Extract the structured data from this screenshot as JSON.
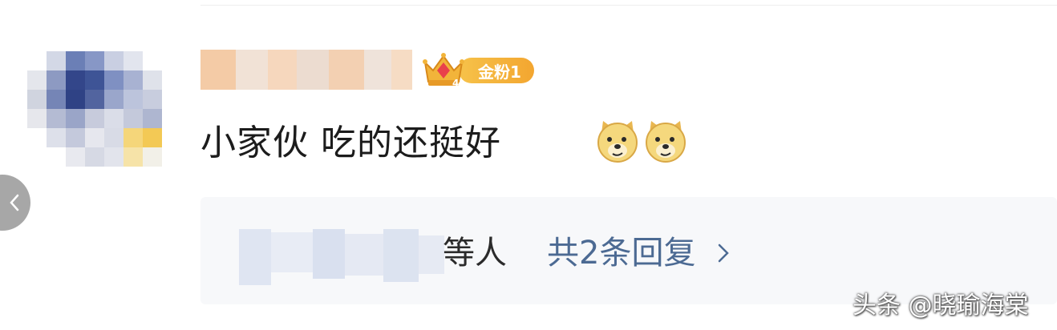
{
  "comment": {
    "badge_label": "金粉1",
    "badge_level": "4",
    "text": "小家伙 吃的还挺好",
    "emoji": [
      "doge-emoji",
      "doge-emoji"
    ]
  },
  "replies": {
    "people_suffix": "等人",
    "link_text": "共2条回复"
  },
  "watermark": "头条 @晓瑜海棠",
  "colors": {
    "link": "#4c6a93",
    "badge": "#f3a630",
    "reply_bg": "#f7f8fa"
  }
}
